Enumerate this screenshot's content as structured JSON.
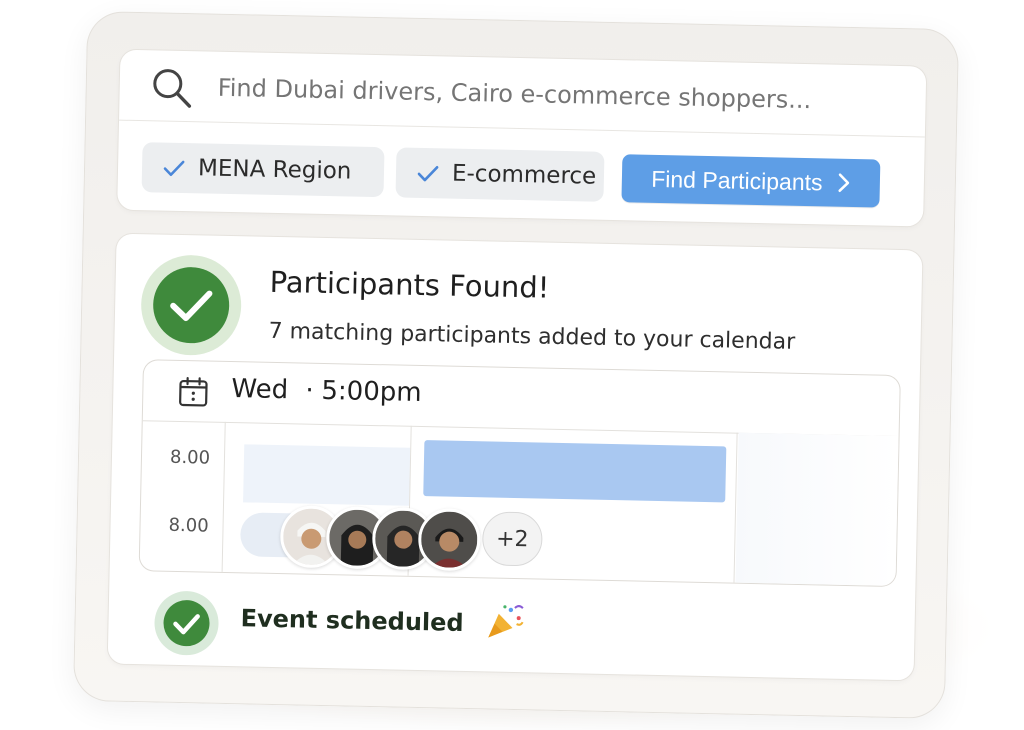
{
  "search": {
    "placeholder": "Find Dubai drivers, Cairo e-commerce shoppers..."
  },
  "filters": [
    {
      "label": "MENA Region",
      "checked": true
    },
    {
      "label": "E-commerce",
      "checked": true
    }
  ],
  "find_button": {
    "label": "Find Participants",
    "icon": "chevron-right-icon"
  },
  "result": {
    "title": "Participants Found!",
    "subtitle": "7 matching participants added to your calendar"
  },
  "calendar": {
    "day": "Wed",
    "separator": "·",
    "time": "5:00pm",
    "time_labels": [
      "8.00",
      "8.00"
    ],
    "more_count": "+2",
    "avatar_count": 4
  },
  "scheduled": {
    "label": "Event scheduled",
    "icon": "party-popper-icon"
  },
  "colors": {
    "accent": "#5e9ee6",
    "success": "#3f8a3c",
    "event_block": "#a9c8f1"
  }
}
